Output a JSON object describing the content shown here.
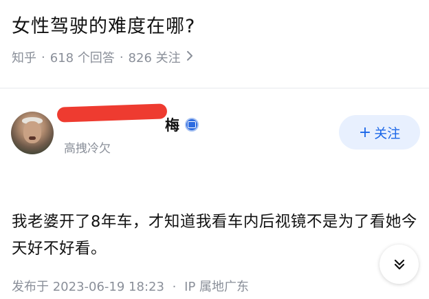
{
  "question": {
    "title": "女性驾驶的难度在哪?",
    "source": "知乎",
    "answers_count": "618 个回答",
    "followers_count": "826 关注"
  },
  "author": {
    "name_visible": "梅",
    "subtitle": "高拽冷欠",
    "follow_label": "关注"
  },
  "answer": {
    "text": "我老婆开了8年车，才知道我看车内后视镜不是为了看她今天好不好看。",
    "published": "发布于 2023-06-19 18:23",
    "ip_location": "IP 属地广东"
  },
  "colors": {
    "accent": "#1a66e8",
    "follow_bg": "#e8f0fe",
    "muted": "#8a8f99",
    "redaction": "#ee3b30"
  },
  "icons": {
    "chevron": "chevron-right-icon",
    "verified": "verified-badge-icon",
    "expand": "double-chevron-down-icon"
  }
}
